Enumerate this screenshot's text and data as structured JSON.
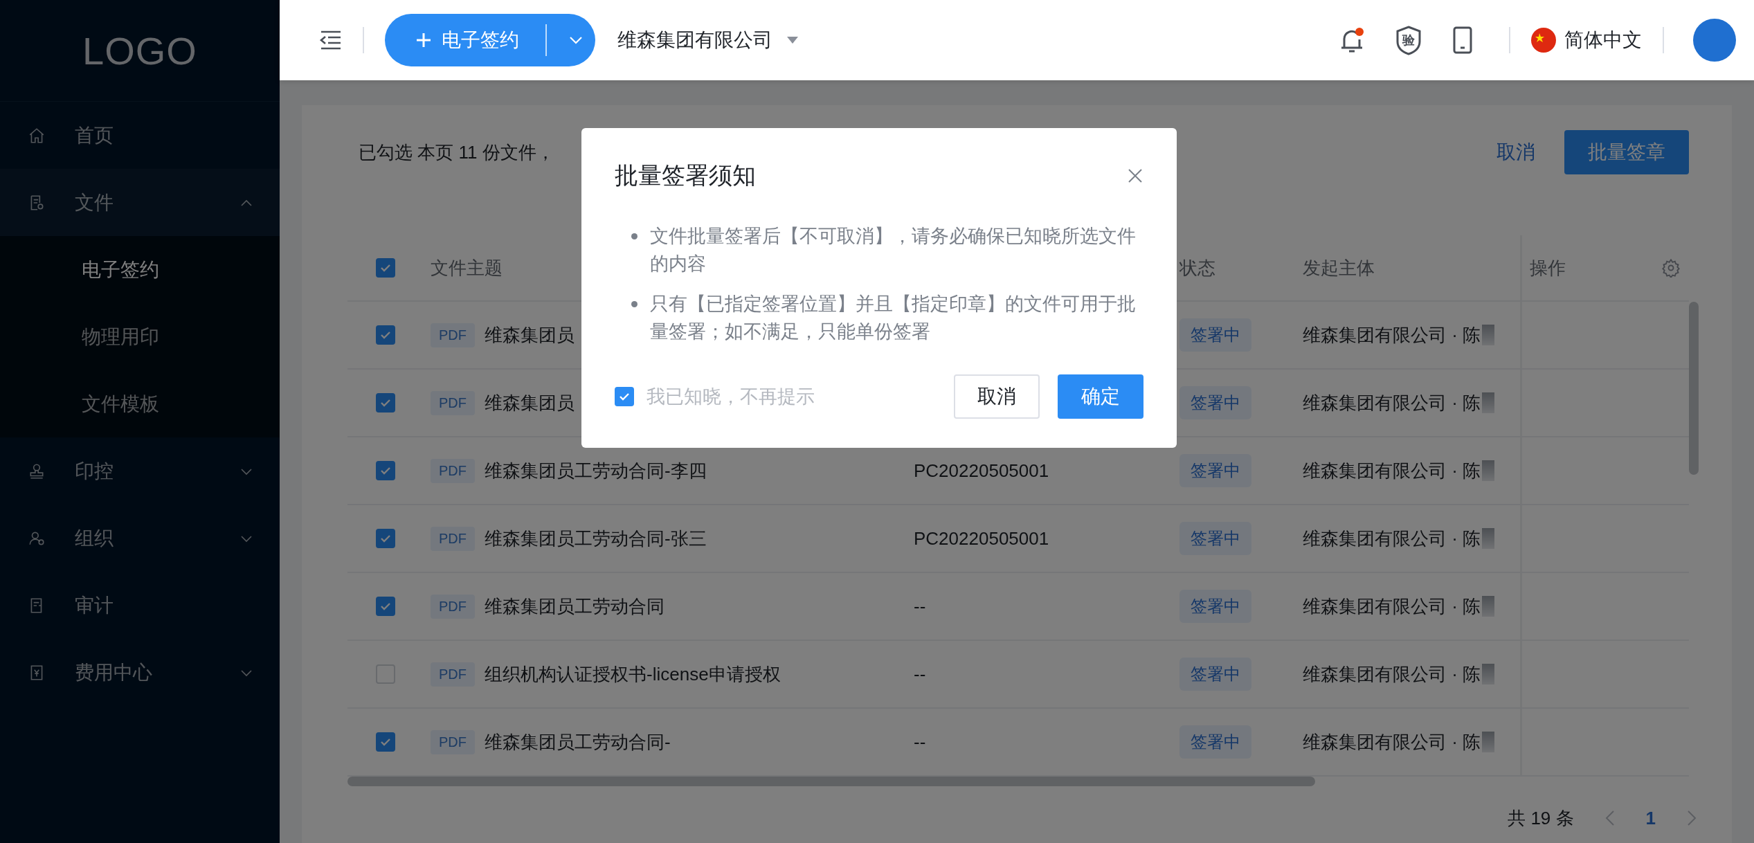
{
  "sidebar": {
    "logo": "LOGO",
    "items": [
      {
        "kind": "link",
        "label": "首页",
        "selected": false
      },
      {
        "kind": "group",
        "label": "文件",
        "expanded": true,
        "children": [
          {
            "label": "电子签约",
            "selected": true
          },
          {
            "label": "物理用印",
            "selected": false
          },
          {
            "label": "文件模板",
            "selected": false
          }
        ]
      },
      {
        "kind": "group",
        "label": "印控",
        "expanded": false
      },
      {
        "kind": "group",
        "label": "组织",
        "expanded": false
      },
      {
        "kind": "link",
        "label": "审计",
        "selected": false
      },
      {
        "kind": "group",
        "label": "费用中心",
        "expanded": false
      }
    ]
  },
  "topbar": {
    "new_button": "电子签约",
    "company": "维森集团有限公司",
    "notifications": {
      "unread": true
    },
    "verify_badge": "验",
    "language": "简体中文"
  },
  "toolbar": {
    "selection_text": "已勾选 本页 11 份文件，",
    "cancel": "取消",
    "batch_sign": "批量签章"
  },
  "table": {
    "header_checked": true,
    "columns": {
      "subject": "文件主题",
      "status": "状态",
      "initiator": "发起主体",
      "actions": "操作"
    },
    "rows": [
      {
        "checked": true,
        "type": "PDF",
        "name": "维森集团员",
        "status": "签署中",
        "initiator": "维森集团有限公司 · 陈"
      },
      {
        "checked": true,
        "type": "PDF",
        "name": "维森集团员",
        "status": "签署中",
        "initiator": "维森集团有限公司 · 陈"
      },
      {
        "checked": true,
        "type": "PDF",
        "name": "维森集团员工劳动合同-李四",
        "code": "PC20220505001",
        "status": "签署中",
        "initiator": "维森集团有限公司 · 陈"
      },
      {
        "checked": true,
        "type": "PDF",
        "name": "维森集团员工劳动合同-张三",
        "code": "PC20220505001",
        "status": "签署中",
        "initiator": "维森集团有限公司 · 陈"
      },
      {
        "checked": true,
        "type": "PDF",
        "name": "维森集团员工劳动合同",
        "code": "--",
        "status": "签署中",
        "initiator": "维森集团有限公司 · 陈"
      },
      {
        "checked": false,
        "type": "PDF",
        "name": "组织机构认证授权书-license申请授权",
        "code": "--",
        "status": "签署中",
        "initiator": "维森集团有限公司 · 陈"
      },
      {
        "checked": true,
        "type": "PDF",
        "name": "维森集团员工劳动合同-",
        "code": "--",
        "status": "签署中",
        "initiator": "维森集团有限公司 · 陈"
      }
    ]
  },
  "pagination": {
    "total": "共 19 条",
    "pages": [
      {
        "label": "1",
        "selected": true
      }
    ]
  },
  "modal": {
    "title": "批量签署须知",
    "bullets": [
      "文件批量签署后【不可取消】，请务必确保已知晓所选文件的内容",
      "只有【已指定签署位置】并且【指定印章】的文件可用于批量签署；如不满足，只能单份签署"
    ],
    "remember": {
      "label": "我已知晓，不再提示",
      "checked": true
    },
    "cancel": "取消",
    "confirm": "确定"
  }
}
